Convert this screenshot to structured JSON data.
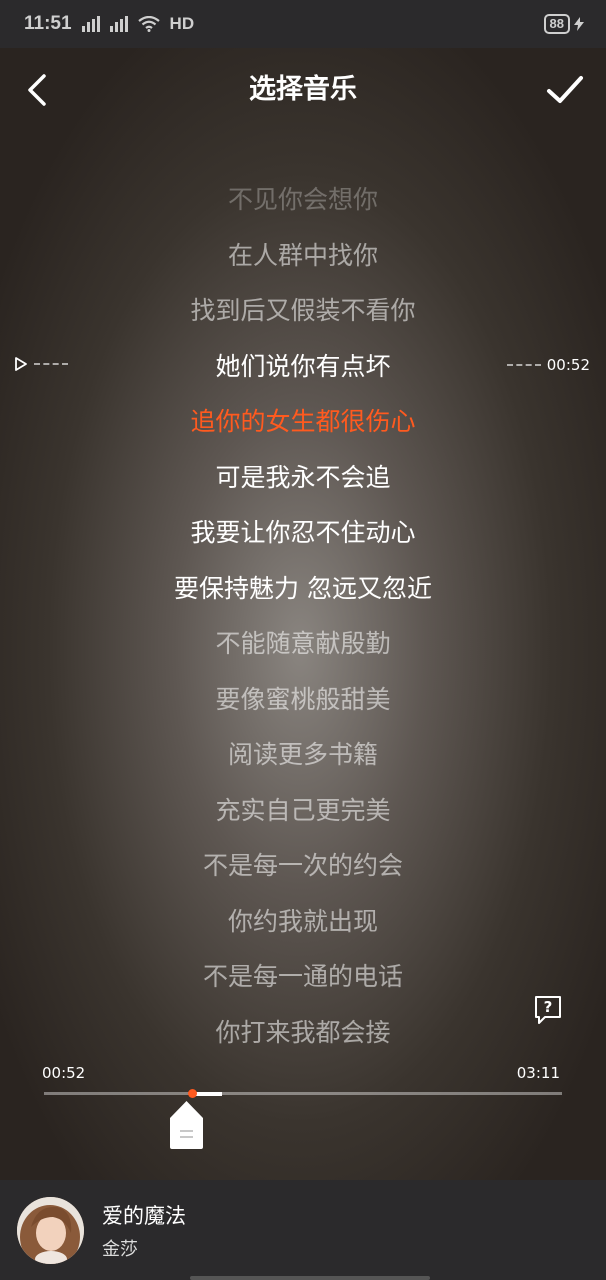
{
  "status_bar": {
    "time": "11:51",
    "network": "HD",
    "battery": "88"
  },
  "header": {
    "title": "选择音乐"
  },
  "lyrics": [
    "不见你会想你",
    "在人群中找你",
    "找到后又假装不看你",
    "她们说你有点坏",
    "追你的女生都很伤心",
    "可是我永不会追",
    "我要让你忍不住动心",
    "要保持魅力 忽远又忽近",
    "不能随意献殷勤",
    "要像蜜桃般甜美",
    "阅读更多书籍",
    "充实自己更完美",
    "不是每一次的约会",
    "你约我就出现",
    "不是每一通的电话",
    "你打来我都会接"
  ],
  "scroll_marker": {
    "time": "00:52"
  },
  "progress": {
    "start_time": "00:52",
    "end_time": "03:11",
    "fraction": 0.28
  },
  "song": {
    "title": "爱的魔法",
    "artist": "金莎"
  },
  "colors": {
    "accent": "#ff5a1f"
  }
}
